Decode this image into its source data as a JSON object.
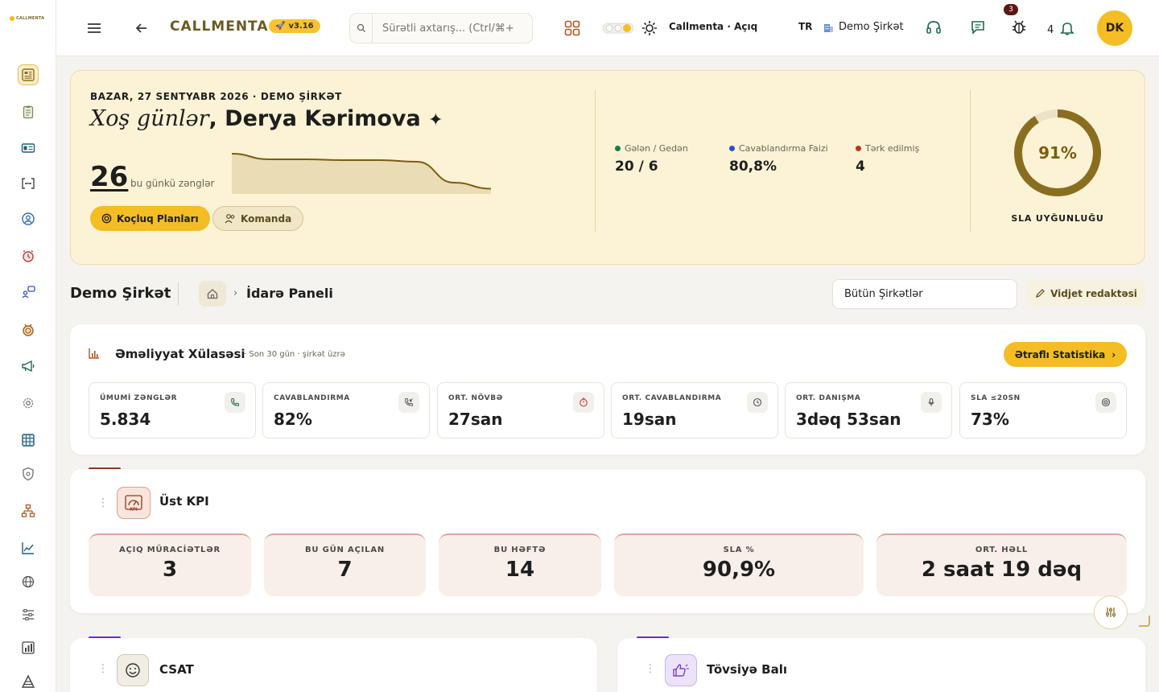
{
  "brand": {
    "logo_text": "CALLMENTA",
    "name": "CALLMENTA",
    "version": "v3.16"
  },
  "search": {
    "placeholder": "Sürətli axtarış... (Ctrl/⌘+"
  },
  "topbar": {
    "theme_label": "Callmenta · Açıq",
    "language": "TR",
    "company": "Demo Şirkət",
    "headset_badge": "3",
    "notifications_count": "4",
    "avatar_initials": "DK"
  },
  "sidebar": {
    "items": [
      {
        "icon": "dashboard-icon",
        "active": true
      },
      {
        "icon": "clipboard-icon",
        "active": false
      },
      {
        "icon": "id-card-icon",
        "active": false
      },
      {
        "icon": "api-brackets-icon",
        "active": false
      },
      {
        "icon": "user-circle-icon",
        "active": false
      },
      {
        "icon": "alarm-icon",
        "active": false
      },
      {
        "icon": "user-chat-icon",
        "active": false
      },
      {
        "icon": "medal-icon",
        "active": false
      },
      {
        "icon": "megaphone-icon",
        "active": false
      },
      {
        "icon": "settings-cog-icon",
        "active": false
      },
      {
        "icon": "grid-board-icon",
        "active": false
      },
      {
        "icon": "shield-icon",
        "active": false
      },
      {
        "icon": "org-chart-icon",
        "active": false
      },
      {
        "icon": "line-chart-icon",
        "active": false
      },
      {
        "icon": "globe-icon",
        "active": false
      },
      {
        "icon": "list-sliders-icon",
        "active": false
      },
      {
        "icon": "bar-report-icon",
        "active": false
      },
      {
        "icon": "pyramid-icon",
        "active": false
      }
    ]
  },
  "hero": {
    "date_line": "BAZAR, 27 SENTYABR 2026 · DEMO ŞİRKƏT",
    "greeting": "Xoş günlər",
    "user_name": "Derya Kərimova",
    "calls_today": "26",
    "calls_label": "bu günkü zənglər",
    "spark_values": [
      0.92,
      0.78,
      0.78,
      0.76,
      0.76,
      0.72,
      0.2,
      0.05
    ],
    "coaching_button": "Koçluq Planları",
    "team_button": "Komanda",
    "stats": [
      {
        "label": "Gələn / Gedən",
        "value": "20 / 6",
        "color": "#1d7a4b"
      },
      {
        "label": "Cavablandırma Faizi",
        "value": "80,8%",
        "color": "#2a4fc9"
      },
      {
        "label": "Tərk edilmiş",
        "value": "4",
        "color": "#c2301f"
      }
    ],
    "sla_value": "91%",
    "sla_fraction": 0.91,
    "sla_label": "SLA UYĞUNLUĞU"
  },
  "breadcrumb": {
    "company": "Demo Şirkət",
    "page": "İdarə Paneli",
    "company_filter": "Bütün Şirkətlər",
    "widget_edit": "Vidjet redaktəsi"
  },
  "ops": {
    "title": "Əməliyyat Xülasəsi",
    "subtitle": "· Son 30 gün · şirkət üzrə",
    "details_button": "Ətraflı Statistika",
    "metrics": [
      {
        "label": "ÜMUMİ ZƏNGLƏR",
        "value": "5.834",
        "icon": "phone-icon"
      },
      {
        "label": "CAVABLANDIRMA",
        "value": "82%",
        "icon": "phone-incoming-icon"
      },
      {
        "label": "ORT. NÖVBƏ",
        "value": "27san",
        "icon": "timer-icon"
      },
      {
        "label": "ORT. CAVABLANDIRMA",
        "value": "19san",
        "icon": "clock-icon"
      },
      {
        "label": "ORT. DANIŞMA",
        "value": "3dəq 53san",
        "icon": "microphone-icon"
      },
      {
        "label": "SLA ≤20SN",
        "value": "73%",
        "icon": "target-icon"
      }
    ]
  },
  "kpi": {
    "title": "Üst KPI",
    "tiles": [
      {
        "label": "AÇIQ MÜRACİƏTLƏR",
        "value": "3"
      },
      {
        "label": "BU GÜN AÇILAN",
        "value": "7"
      },
      {
        "label": "BU HƏFTƏ",
        "value": "14"
      },
      {
        "label": "SLA %",
        "value": "90,9%"
      },
      {
        "label": "ORT. HƏLL",
        "value": "2 saat 19 dəq"
      }
    ]
  },
  "csat": {
    "title": "CSAT"
  },
  "recommend": {
    "title": "Tövsiyə Balı"
  },
  "colors": {
    "accent": "#f5bd24",
    "brand_text": "#6b5a22",
    "ring": "#8a6e1f",
    "kpi_accent": "#8a3a1c",
    "csat_accent": "#6a2cc4"
  }
}
